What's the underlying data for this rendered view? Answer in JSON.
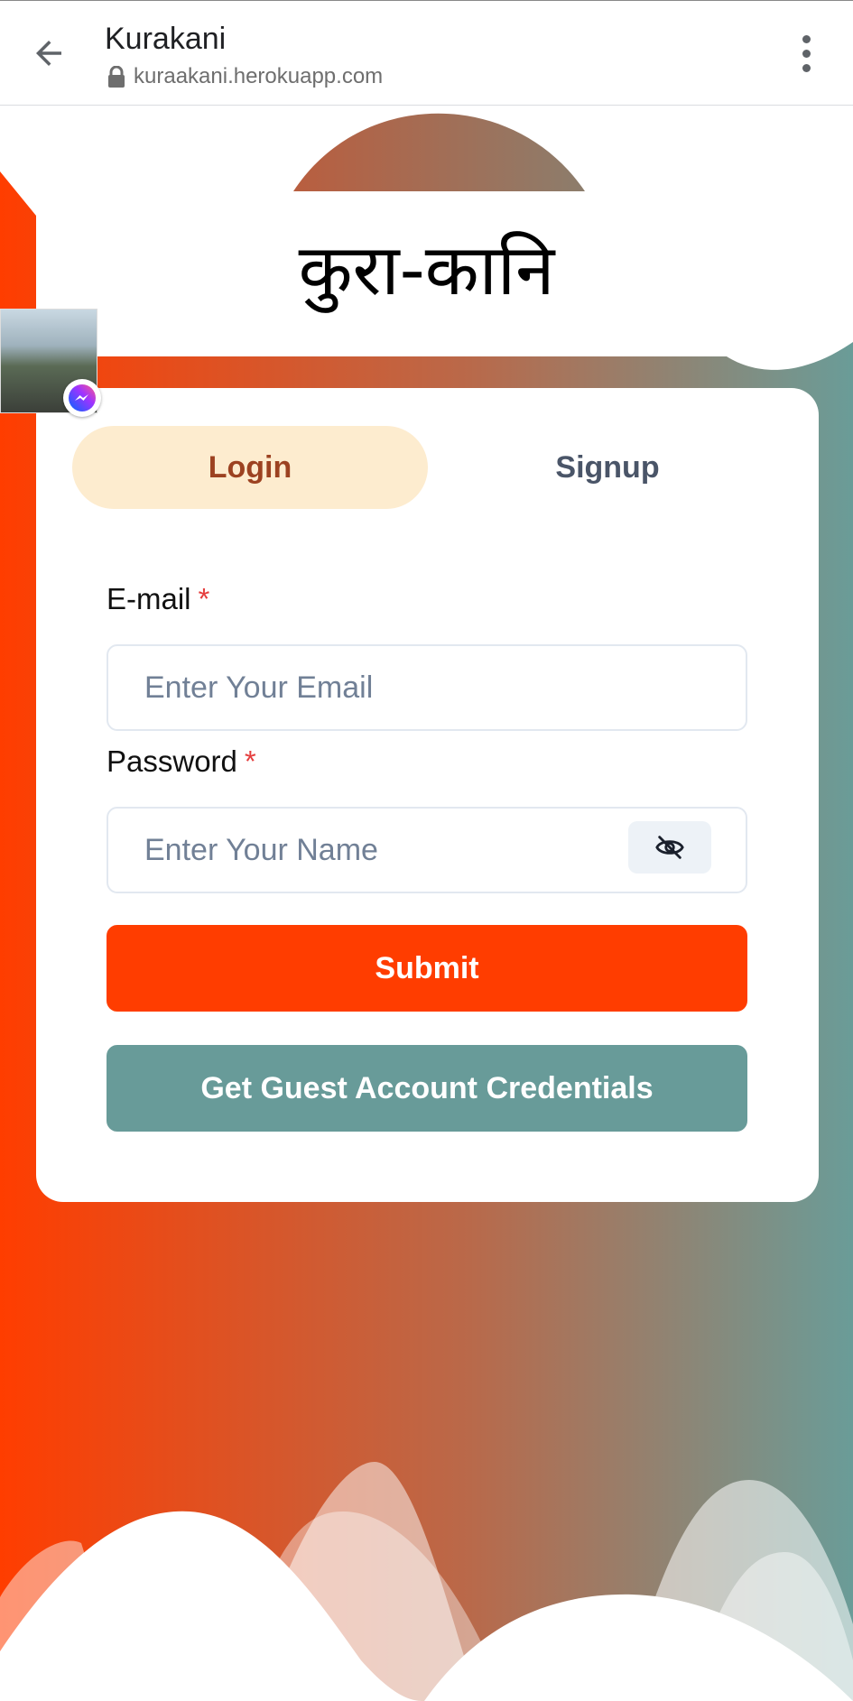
{
  "browser": {
    "title": "Kurakani",
    "url": "kuraakani.herokuapp.com",
    "back_icon": "arrow-left-icon",
    "lock_icon": "lock-icon",
    "menu_icon": "more-vertical-icon"
  },
  "brand": {
    "name": "कुरा-कानि"
  },
  "chat_head": {
    "badge_icon": "messenger-icon"
  },
  "tabs": [
    {
      "label": "Login",
      "active": true
    },
    {
      "label": "Signup",
      "active": false
    }
  ],
  "form": {
    "email_label": "E-mail",
    "email_placeholder": "Enter Your Email",
    "password_label": "Password",
    "password_placeholder": "Enter Your Name",
    "required_mark": "*",
    "toggle_icon": "eye-off-icon",
    "submit_label": "Submit",
    "guest_label": "Get Guest Account Credentials"
  },
  "colors": {
    "accent": "#ff3d00",
    "teal": "#689b99",
    "active_tab_bg": "#fdeccf",
    "active_tab_text": "#9c4221",
    "required": "#e53e3e"
  }
}
